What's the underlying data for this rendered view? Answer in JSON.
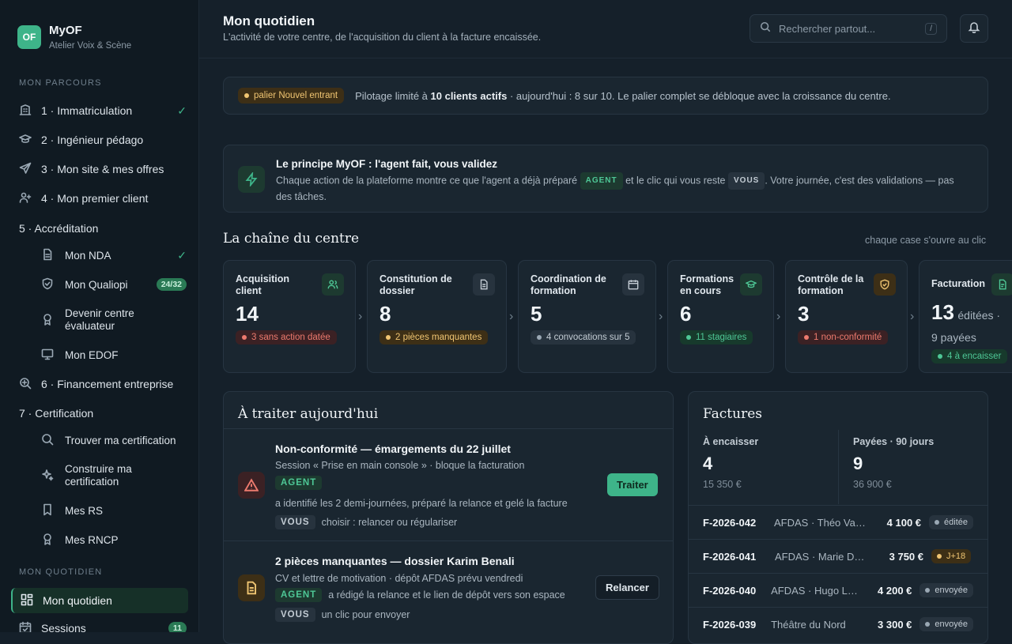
{
  "brand": {
    "logo": "OF",
    "name": "MyOF",
    "subtitle": "Atelier Voix & Scène"
  },
  "sidebar": {
    "section_parcours": "MON PARCOURS",
    "section_quotidien": "MON QUOTIDIEN",
    "items": [
      {
        "label": "1 · Immatriculation",
        "icon": "building-icon",
        "check": "✓"
      },
      {
        "label": "2 · Ingénieur pédago",
        "icon": "graduation-cap-icon"
      },
      {
        "label": "3 · Mon site & mes offres",
        "icon": "send-icon"
      },
      {
        "label": "4 · Mon premier client",
        "icon": "user-plus-icon"
      },
      {
        "label": "5 · Accréditation"
      },
      {
        "label": "Mon NDA",
        "icon": "document-icon",
        "check": "✓"
      },
      {
        "label": "Mon Qualiopi",
        "icon": "shield-icon",
        "badge": "24/32"
      },
      {
        "label": "Devenir centre évaluateur",
        "icon": "award-icon"
      },
      {
        "label": "Mon EDOF",
        "icon": "monitor-icon"
      },
      {
        "label": "6 · Financement entreprise",
        "icon": "zoom-search-icon"
      },
      {
        "label": "7 · Certification"
      },
      {
        "label": "Trouver ma certification",
        "icon": "search-icon"
      },
      {
        "label": "Construire ma certification",
        "icon": "sparkle-icon"
      },
      {
        "label": "Mes RS",
        "icon": "bookmark-icon"
      },
      {
        "label": "Mes RNCP",
        "icon": "award-icon"
      },
      {
        "label": "Mon quotidien",
        "icon": "dashboard-icon"
      },
      {
        "label": "Sessions",
        "icon": "calendar-check-icon",
        "badge": "11"
      }
    ]
  },
  "header": {
    "title": "Mon quotidien",
    "subtitle": "L'activité de votre centre, de l'acquisition du client à la facture encaissée.",
    "search_placeholder": "Rechercher partout...",
    "search_kbd": "/"
  },
  "tier": {
    "tag": "palier Nouvel entrant",
    "text_before": "Pilotage limité à ",
    "text_bold": "10 clients actifs",
    "text_after": " · aujourd'hui : 8 sur 10. Le palier complet se débloque avec la croissance du centre."
  },
  "principle": {
    "title": "Le principe MyOF : l'agent fait, vous validez",
    "p1": "Chaque action de la plateforme montre ce que l'agent a déjà préparé ",
    "agent": "AGENT",
    "p2": " et le clic qui vous reste ",
    "vous": "VOUS",
    "p3": ". Votre journée, c'est des validations — pas des tâches."
  },
  "chain": {
    "title": "La chaîne du centre",
    "hint": "chaque case s'ouvre au clic",
    "stages": [
      {
        "title": "Acquisition client",
        "value": "14",
        "badge": "3 sans action datée",
        "tone": "red",
        "icon": "users-icon"
      },
      {
        "title": "Constitution de dossier",
        "value": "8",
        "badge": "2 pièces manquantes",
        "tone": "amber",
        "icon": "file-text-icon"
      },
      {
        "title": "Coordination de formation",
        "value": "5",
        "badge": "4 convocations sur 5",
        "tone": "gray",
        "icon": "calendar-icon"
      },
      {
        "title": "Formations en cours",
        "value": "6",
        "badge": "11 stagiaires",
        "tone": "green",
        "icon": "graduation-cap-icon"
      },
      {
        "title": "Contrôle de la formation",
        "value": "3",
        "badge": "1 non-conformité",
        "tone": "red",
        "icon": "shield-alert-icon"
      },
      {
        "title": "Facturation",
        "value": "13",
        "value_suffix": "éditées ·",
        "value_line2": "9 payées",
        "badge": "4 à encaisser",
        "tone": "green",
        "icon": "invoice-icon"
      }
    ]
  },
  "todo": {
    "title": "À traiter aujourd'hui",
    "items": [
      {
        "title": "Non-conformité — émargements du 22 juillet",
        "subtitle": "Session « Prise en main console » · bloque la facturation",
        "agent_label": "AGENT",
        "agent_text": "a identifié les 2 demi-journées, préparé la relance et gelé la facture",
        "vous_label": "VOUS",
        "vous_text": "choisir : relancer ou régulariser",
        "action": "Traiter"
      },
      {
        "title": "2 pièces manquantes — dossier Karim Benali",
        "subtitle": "CV et lettre de motivation · dépôt AFDAS prévu vendredi",
        "agent_label": "AGENT",
        "agent_text": "a rédigé la relance et le lien de dépôt vers son espace",
        "vous_label": "VOUS",
        "vous_text": "un clic pour envoyer",
        "action": "Relancer"
      }
    ]
  },
  "factures": {
    "title": "Factures",
    "kpi_a_label": "À encaisser",
    "kpi_a_value": "4",
    "kpi_a_amount": "15 350 €",
    "kpi_b_label": "Payées · 90 jours",
    "kpi_b_value": "9",
    "kpi_b_amount": "36 900 €",
    "rows": [
      {
        "id": "F-2026-042",
        "who": "AFDAS · Théo Vasseur",
        "amount": "4 100 €",
        "status": "éditée",
        "tone": "gray"
      },
      {
        "id": "F-2026-041",
        "who": "AFDAS · Marie Dupont",
        "amount": "3 750 €",
        "status": "J+18",
        "tone": "amber"
      },
      {
        "id": "F-2026-040",
        "who": "AFDAS · Hugo Lambert",
        "amount": "4 200 €",
        "status": "envoyée",
        "tone": "gray"
      },
      {
        "id": "F-2026-039",
        "who": "Théâtre du Nord",
        "amount": "3 300 €",
        "status": "envoyée",
        "tone": "gray"
      }
    ]
  },
  "colors": {
    "accent": "#3eb489",
    "red": "#ec7a6e",
    "amber": "#f0c572",
    "bg": "#15202a",
    "sidebar": "#101a22"
  }
}
